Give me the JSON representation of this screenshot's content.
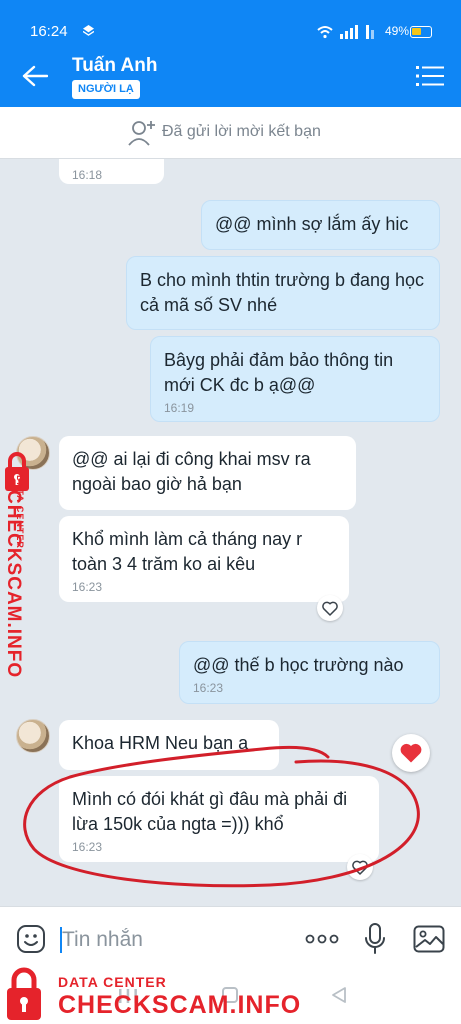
{
  "status_bar": {
    "time": "16:24",
    "battery": "49%"
  },
  "header": {
    "contact_name": "Tuấn Anh",
    "badge": "NGƯỜI LẠ"
  },
  "friend_request": {
    "text": "Đã gửi lời mời kết bạn"
  },
  "messages": [
    {
      "dir": "in",
      "text": "",
      "time": "16:18"
    },
    {
      "dir": "out",
      "text": "@@ mình sợ lắm ấy hic",
      "time": ""
    },
    {
      "dir": "out",
      "text": "B cho mình thtin trường b đang học cả mã số SV nhé",
      "time": ""
    },
    {
      "dir": "out",
      "text": "Bâyg phải đảm bảo thông tin mới CK đc b ạ@@",
      "time": "16:19"
    },
    {
      "dir": "in",
      "text": "@@ ai lại đi công khai msv ra ngoài bao giờ hả bạn",
      "time": ""
    },
    {
      "dir": "in",
      "text": "Khổ mình làm cả tháng nay r toàn 3 4 trăm ko ai kêu",
      "time": "16:23"
    },
    {
      "dir": "out",
      "text": "@@ thế b học trường nào",
      "time": "16:23"
    },
    {
      "dir": "in",
      "text": "Khoa HRM Neu bạn ạ",
      "time": ""
    },
    {
      "dir": "in",
      "text": "Mình có đói khát gì đâu mà phải đi lừa 150k của ngta =))) khổ",
      "time": "16:23"
    }
  ],
  "input": {
    "placeholder": "Tin nhắn"
  },
  "watermark": {
    "small": "DATA CENTER",
    "big": "CHECKSCAM.INFO"
  },
  "colors": {
    "accent": "#0f86f5",
    "incoming": "#ffffff",
    "outgoing": "#d5ecfc",
    "annotation": "#d21f2a",
    "watermark": "#e5232b"
  },
  "icons": [
    "back-arrow-icon",
    "menu-icon",
    "add-friend-icon",
    "heart-outline-icon",
    "heart-filled-icon",
    "emoji-icon",
    "more-dots-icon",
    "microphone-icon",
    "image-icon"
  ]
}
